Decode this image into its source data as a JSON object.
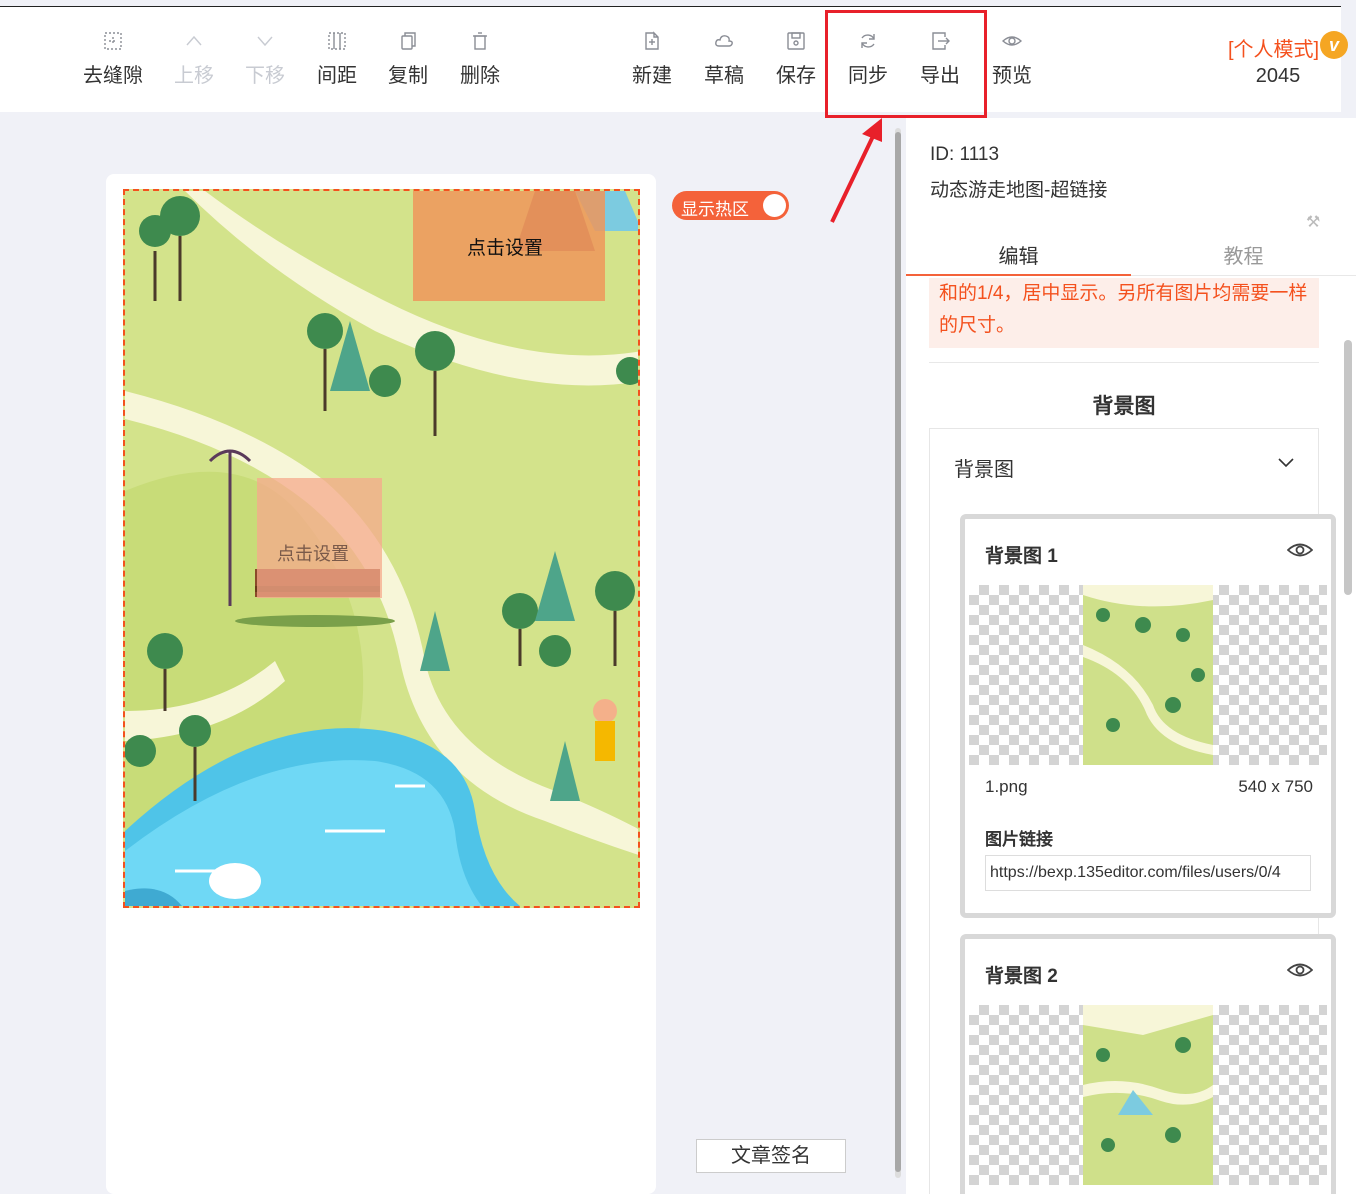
{
  "toolbar": {
    "left": [
      {
        "label": "去缝隙",
        "icon": "grid-icon",
        "disabled": false
      },
      {
        "label": "上移",
        "icon": "chevron-up-icon",
        "disabled": true
      },
      {
        "label": "下移",
        "icon": "chevron-down-icon",
        "disabled": true
      },
      {
        "label": "间距",
        "icon": "spacing-icon",
        "disabled": false
      },
      {
        "label": "复制",
        "icon": "copy-icon",
        "disabled": false
      },
      {
        "label": "删除",
        "icon": "trash-icon",
        "disabled": false
      }
    ],
    "right": [
      {
        "label": "新建",
        "icon": "new-file-icon"
      },
      {
        "label": "草稿",
        "icon": "cloud-icon"
      },
      {
        "label": "保存",
        "icon": "save-icon"
      },
      {
        "label": "同步",
        "icon": "sync-icon"
      },
      {
        "label": "导出",
        "icon": "export-icon"
      },
      {
        "label": "预览",
        "icon": "eye-icon"
      }
    ],
    "mode_label": "[个人模式]",
    "mode_badge": "v",
    "count": "2045"
  },
  "canvas": {
    "hotspot_label_1": "点击设置",
    "hotspot_label_2": "点击设置",
    "toggle_label": "显示热区",
    "sign_button": "文章签名"
  },
  "panel": {
    "id_text": "ID: 1113",
    "name": "动态游走地图-超链接",
    "tabs": [
      "编辑",
      "教程"
    ],
    "notice": "和的1/4，居中显示。另所有图片均需要一样的尺寸。",
    "section_title": "背景图",
    "collapse_title": "背景图",
    "cards": [
      {
        "title": "背景图 1",
        "file": "1.png",
        "dims": "540 x 750",
        "link_label": "图片链接",
        "link_value": "https://bexp.135editor.com/files/users/0/4"
      },
      {
        "title": "背景图 2"
      }
    ]
  },
  "colors": {
    "accent": "#f4623a",
    "highlight": "#e8202a"
  }
}
